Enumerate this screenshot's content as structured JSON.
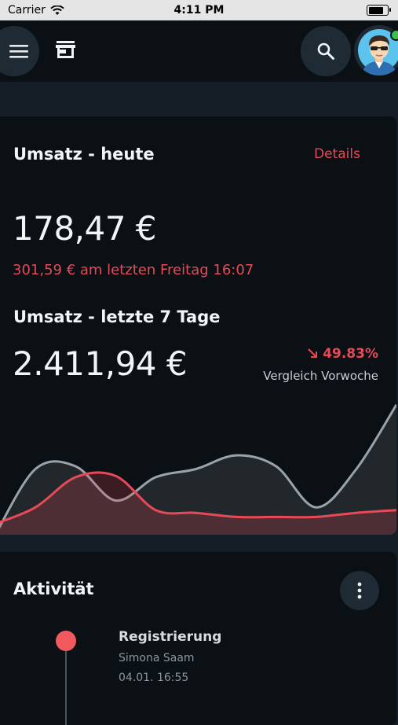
{
  "status_bar": {
    "carrier": "Carrier",
    "time": "4:11 PM",
    "battery_level": 0.9
  },
  "app_bar": {
    "icons": [
      "menu-icon",
      "store-icon",
      "search-icon",
      "avatar"
    ],
    "online_indicator_color": "#38c24a"
  },
  "sales_today": {
    "title": "Umsatz - heute",
    "details_label": "Details",
    "amount": "178,47 €",
    "comparison": "301,59 € am letzten Freitag 16:07"
  },
  "sales_week": {
    "title": "Umsatz - letzte 7 Tage",
    "amount": "2.411,94 €",
    "change": "49.83%",
    "change_direction": "down",
    "change_label": "Vergleich Vorwoche"
  },
  "chart_data": {
    "type": "area",
    "series": [
      {
        "values": [
          0.0,
          0.48,
          0.5,
          0.25,
          0.42,
          0.48,
          0.58,
          0.5,
          0.2,
          0.48,
          0.95
        ],
        "color": "#9aa3aa"
      },
      {
        "values": [
          0.08,
          0.2,
          0.42,
          0.43,
          0.18,
          0.16,
          0.13,
          0.13,
          0.13,
          0.16,
          0.18
        ],
        "color": "#e74a57"
      }
    ],
    "ylim": [
      0,
      1
    ]
  },
  "activity": {
    "title": "Aktivität",
    "items": [
      {
        "title": "Registrierung",
        "subtitle": "Simona Saam",
        "time": "04.01. 16:55"
      }
    ]
  },
  "colors": {
    "background": "#151d26",
    "card": "#0b1015",
    "accent_red": "#e74a57",
    "button": "#1e2a34"
  }
}
